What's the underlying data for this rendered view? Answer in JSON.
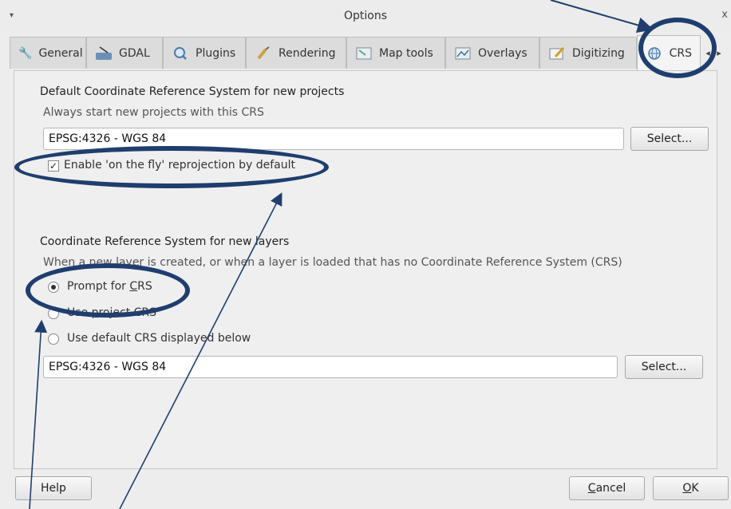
{
  "window": {
    "title": "Options",
    "menu_arrow": "▾",
    "close": "x"
  },
  "tabs": [
    {
      "label": "General",
      "icon": "wrench-icon"
    },
    {
      "label": "GDAL",
      "icon": "gdal-icon"
    },
    {
      "label": "Plugins",
      "icon": "plugins-icon"
    },
    {
      "label": "Rendering",
      "icon": "brush-icon"
    },
    {
      "label": "Map tools",
      "icon": "map-tools-icon"
    },
    {
      "label": "Overlays",
      "icon": "overlays-icon"
    },
    {
      "label": "Digitizing",
      "icon": "digitizing-icon"
    },
    {
      "label": "CRS",
      "icon": "globe-icon",
      "active": true
    }
  ],
  "project_crs": {
    "title": "Default Coordinate Reference System for new projects",
    "hint": "Always start new projects with this CRS",
    "value": "EPSG:4326 - WGS 84",
    "select_label": "Select...",
    "otf_label": "Enable 'on the fly' reprojection by default",
    "otf_checked": true
  },
  "layer_crs": {
    "title": "Coordinate Reference System for new layers",
    "hint": "When a new layer is created, or when a layer is loaded that has no Coordinate Reference System (CRS)",
    "options": [
      {
        "label_pre": "Prompt for ",
        "label_u": "C",
        "label_post": "RS",
        "selected": true
      },
      {
        "label_pre": "Use ",
        "label_u": "p",
        "label_post": "roject CRS",
        "selected": false
      },
      {
        "label_pre": "Use default CRS displayed below",
        "label_u": "",
        "label_post": "",
        "selected": false
      }
    ],
    "value": "EPSG:4326 - WGS 84",
    "select_label": "Select..."
  },
  "footer": {
    "help_label": "Help",
    "cancel_pre": "",
    "cancel_u": "C",
    "cancel_post": "ancel",
    "ok_pre": "",
    "ok_u": "O",
    "ok_post": "K"
  },
  "annotation_color": "#1f3e6e"
}
